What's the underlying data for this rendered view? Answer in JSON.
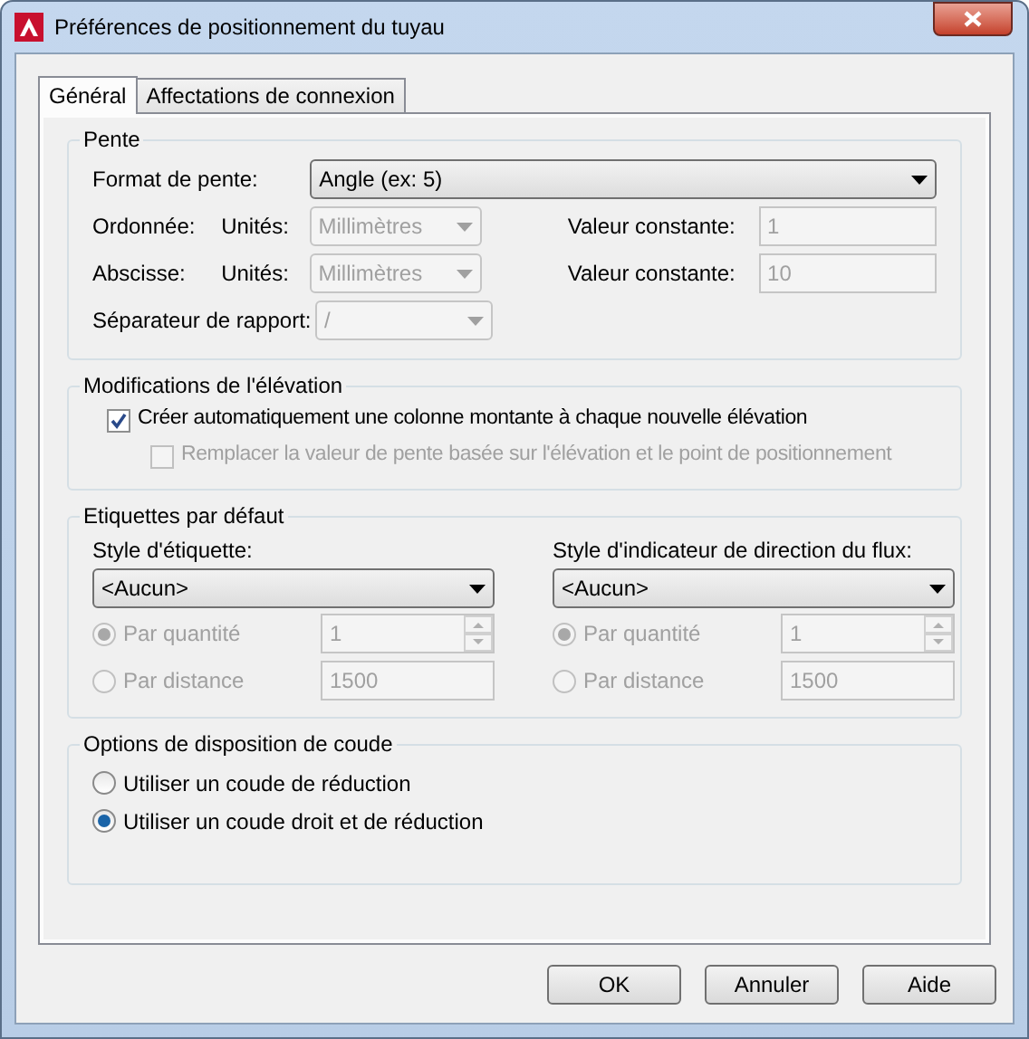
{
  "window": {
    "title": "Préférences de positionnement du tuyau"
  },
  "tabs": [
    {
      "label": "Général",
      "selected": true
    },
    {
      "label": "Affectations de connexion",
      "selected": false
    }
  ],
  "slope": {
    "title": "Pente",
    "format": {
      "label": "Format de pente:",
      "value": "Angle (ex: 5)",
      "disabled": false
    },
    "rows": [
      {
        "label": "Ordonnée:",
        "units_label": "Unités:",
        "units": "Millimètres",
        "constant_label": "Valeur constante:",
        "constant": "1",
        "disabled": true
      },
      {
        "label": "Abscisse:",
        "units_label": "Unités:",
        "units": "Millimètres",
        "constant_label": "Valeur constante:",
        "constant": "10",
        "disabled": true
      }
    ],
    "separator": {
      "label": "Séparateur de rapport:",
      "value": "/",
      "disabled": true
    }
  },
  "elevation": {
    "title": "Modifications de l'élévation",
    "options": [
      {
        "label": "Créer automatiquement une colonne montante à chaque nouvelle élévation",
        "checked": true,
        "disabled": false,
        "children": [
          {
            "label": "Remplacer la valeur de pente basée sur l'élévation et le point de positionnement",
            "checked": false,
            "disabled": true
          }
        ]
      }
    ]
  },
  "labels": {
    "title": "Etiquettes par défaut",
    "columns": [
      {
        "label": "Style d'étiquette:",
        "value": "<Aucun>",
        "options": [
          {
            "label": "Par quantité",
            "selected": true,
            "disabled": true,
            "kind": "spinner",
            "value": "1"
          },
          {
            "label": "Par distance",
            "selected": false,
            "disabled": true,
            "kind": "text",
            "value": "1500"
          }
        ]
      },
      {
        "label": "Style d'indicateur de direction du flux:",
        "value": "<Aucun>",
        "options": [
          {
            "label": "Par quantité",
            "selected": true,
            "disabled": true,
            "kind": "spinner",
            "value": "1"
          },
          {
            "label": "Par distance",
            "selected": false,
            "disabled": true,
            "kind": "text",
            "value": "1500"
          }
        ]
      }
    ]
  },
  "elbow": {
    "title": "Options de disposition de coude",
    "options": [
      {
        "label": "Utiliser un coude de réduction",
        "selected": false
      },
      {
        "label": "Utiliser un coude droit et de réduction",
        "selected": true
      }
    ]
  },
  "buttons": [
    "OK",
    "Annuler",
    "Aide"
  ]
}
